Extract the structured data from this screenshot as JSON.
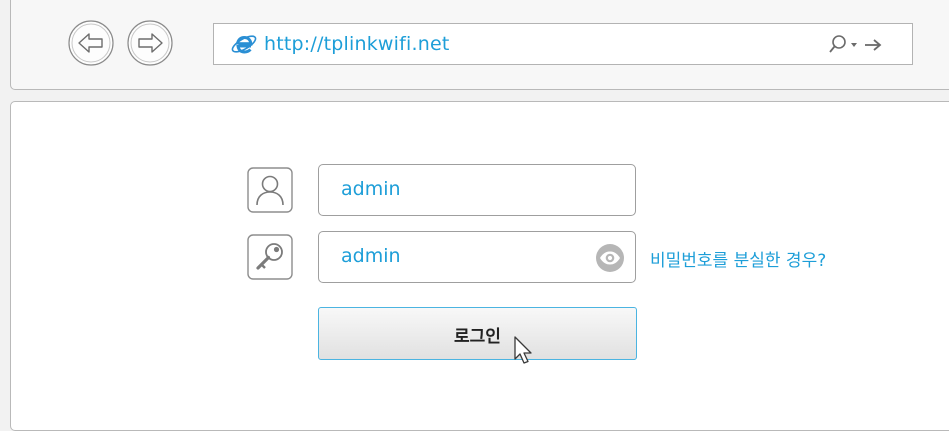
{
  "browser": {
    "url": "http://tplinkwifi.net",
    "icons": {
      "back": "back-arrow-icon",
      "forward": "forward-arrow-icon",
      "page": "internet-explorer-icon",
      "search": "search-icon",
      "dropdown": "dropdown-arrow-icon",
      "go": "go-arrow-icon"
    }
  },
  "login_form": {
    "username": {
      "value": "admin",
      "icon": "user-icon"
    },
    "password": {
      "value": "admin",
      "icon": "key-icon",
      "reveal_icon": "eye-icon"
    },
    "forgot_password_link": "비밀번호를 분실한 경우?",
    "login_button": "로그인"
  },
  "colors": {
    "accent": "#1d9ed8",
    "border": "#b9b9b9",
    "background": "#f2f2f2"
  }
}
